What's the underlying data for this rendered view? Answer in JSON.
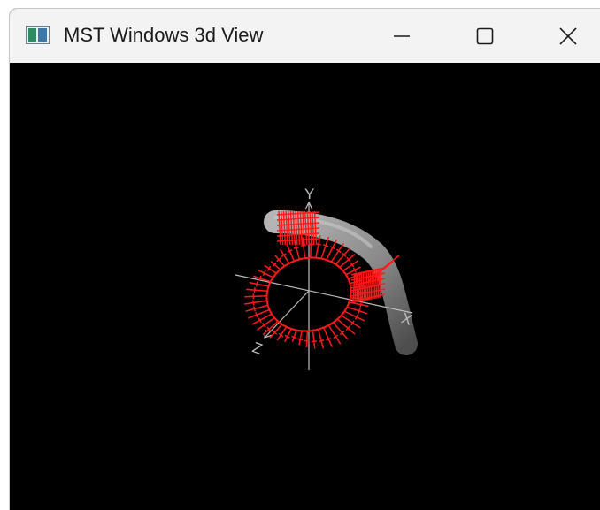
{
  "window": {
    "title": "MST Windows 3d View",
    "icon": "app-window-icon",
    "controls": {
      "minimize_icon": "minimize-icon",
      "maximize_icon": "maximize-icon",
      "close_icon": "close-icon"
    }
  },
  "scene": {
    "background": "#000000",
    "axis_labels": {
      "y": "Y",
      "x": "X",
      "z": "Z"
    },
    "colors": {
      "pipe": "#8a8a8a",
      "vectors": "#ff1a1a",
      "axes": "#bdbdbd"
    }
  }
}
